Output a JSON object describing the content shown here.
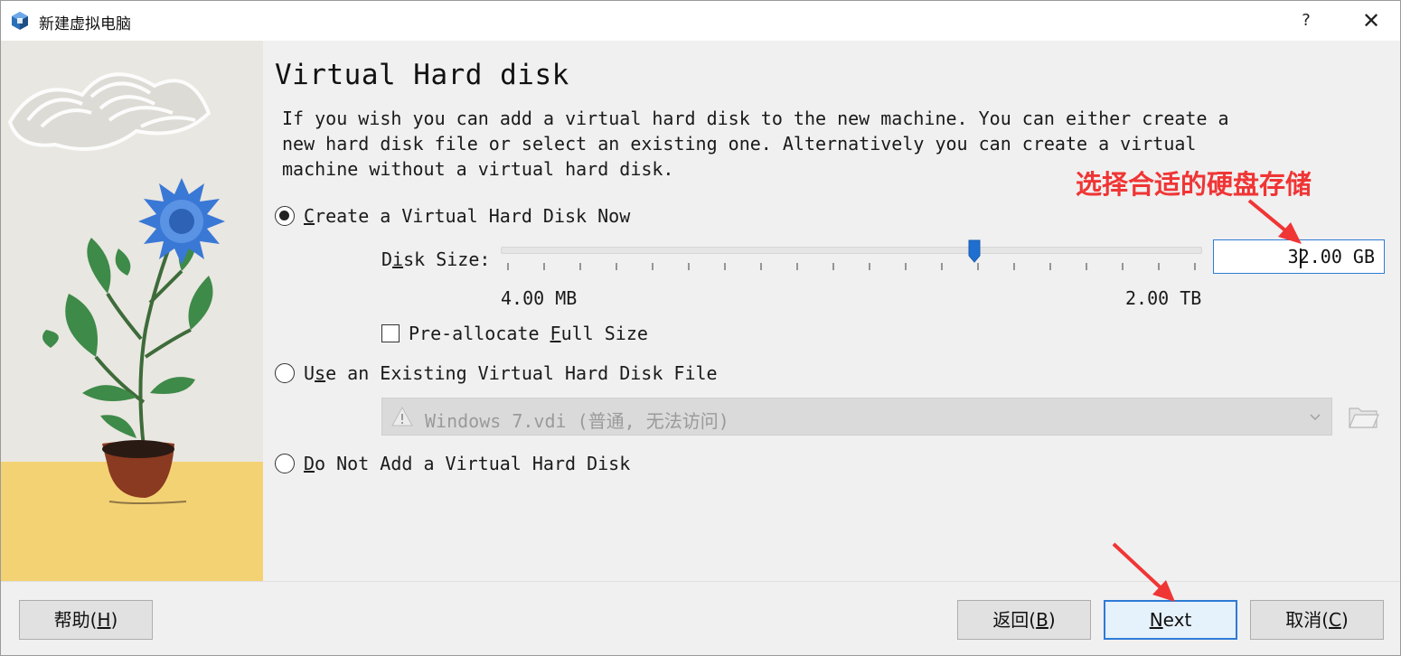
{
  "window": {
    "title": "新建虚拟电脑",
    "help_label": "?",
    "close_label": "✕"
  },
  "page": {
    "title": "Virtual Hard disk",
    "description": "If you wish you can add a virtual hard disk to the new machine. You can either create a\nnew hard disk file or select an existing one. Alternatively you can create a virtual\nmachine without a virtual hard disk."
  },
  "options": {
    "create_now": {
      "accel": "C",
      "rest": "reate a Virtual Hard Disk Now",
      "selected": true
    },
    "use_existing": {
      "pre": "U",
      "accel": "s",
      "rest": "e an Existing Virtual Hard Disk File",
      "selected": false
    },
    "do_not_add": {
      "accel": "D",
      "rest": "o Not Add a Virtual Hard Disk",
      "selected": false
    }
  },
  "disk_size": {
    "label_pre": "D",
    "label_accel": "i",
    "label_rest": "sk Size:",
    "value": "32.00 GB",
    "min_label": "4.00 MB",
    "max_label": "2.00 TB",
    "slider_fraction": 0.675,
    "tick_count": 20
  },
  "preallocate": {
    "label_pre": "Pre-allocate ",
    "label_accel": "F",
    "label_rest": "ull Size",
    "checked": false
  },
  "existing_file": {
    "value": "Windows 7.vdi (普通, 无法访问)",
    "warning_icon": "warning-icon",
    "folder_icon": "folder-icon"
  },
  "annotation": {
    "text": "选择合适的硬盘存储",
    "color": "#f03535"
  },
  "buttons": {
    "help": {
      "label": "帮助(",
      "accel": "H",
      "tail": ")"
    },
    "back": {
      "label": "返回(",
      "accel": "B",
      "tail": ")"
    },
    "next": {
      "accel": "N",
      "rest": "ext"
    },
    "cancel": {
      "label": "取消(",
      "accel": "C",
      "tail": ")"
    }
  },
  "colors": {
    "accent": "#2e7bd6",
    "annotation_red": "#f03535",
    "illustration_yellow": "#f3d273",
    "leaf_green": "#3e8a49",
    "flower_blue": "#3a78d6",
    "pot_red": "#8a3a20"
  }
}
